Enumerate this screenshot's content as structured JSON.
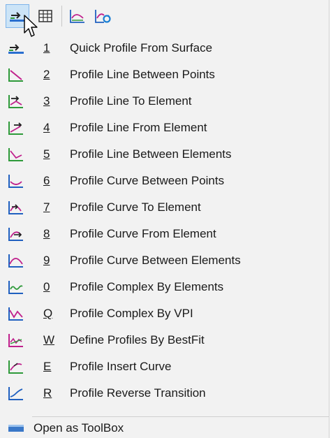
{
  "toolbar": {
    "buttons": [
      {
        "icon": "profile-from-surface-icon",
        "active": true
      },
      {
        "icon": "table-grid-icon",
        "active": false
      },
      {
        "icon": "profile-view-icon",
        "active": false
      },
      {
        "icon": "profile-refresh-icon",
        "active": false
      }
    ]
  },
  "menu": {
    "items": [
      {
        "accel": "1",
        "label": "Quick Profile From Surface",
        "icon": "quick-profile-icon"
      },
      {
        "accel": "2",
        "label": "Profile Line Between Points",
        "icon": "profile-line-points-icon"
      },
      {
        "accel": "3",
        "label": "Profile Line To Element",
        "icon": "profile-line-to-element-icon"
      },
      {
        "accel": "4",
        "label": "Profile Line From Element",
        "icon": "profile-line-from-element-icon"
      },
      {
        "accel": "5",
        "label": "Profile Line Between Elements",
        "icon": "profile-line-between-elements-icon"
      },
      {
        "accel": "6",
        "label": "Profile Curve Between Points",
        "icon": "profile-curve-points-icon"
      },
      {
        "accel": "7",
        "label": "Profile Curve To Element",
        "icon": "profile-curve-to-element-icon"
      },
      {
        "accel": "8",
        "label": "Profile Curve From Element",
        "icon": "profile-curve-from-element-icon"
      },
      {
        "accel": "9",
        "label": "Profile Curve Between Elements",
        "icon": "profile-curve-between-elements-icon"
      },
      {
        "accel": "0",
        "label": "Profile Complex By Elements",
        "icon": "profile-complex-elements-icon"
      },
      {
        "accel": "Q",
        "label": "Profile Complex By VPI",
        "icon": "profile-complex-vpi-icon"
      },
      {
        "accel": "W",
        "label": "Define Profiles By BestFit",
        "icon": "profile-bestfit-icon"
      },
      {
        "accel": "E",
        "label": "Profile Insert Curve",
        "icon": "profile-insert-curve-icon"
      },
      {
        "accel": "R",
        "label": "Profile Reverse Transition",
        "icon": "profile-reverse-transition-icon"
      }
    ],
    "footer_label": "Open as ToolBox"
  },
  "colors": {
    "green": "#2e9a3a",
    "magenta": "#c0208c",
    "blue": "#2060c0",
    "active_bg": "#cce4f7"
  }
}
